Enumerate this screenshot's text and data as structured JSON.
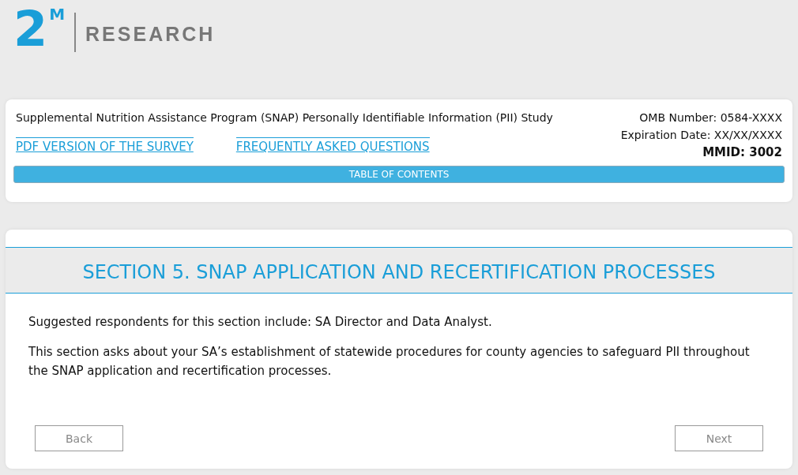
{
  "logo": {
    "mark": "2",
    "superscript": "M",
    "name": "RESEARCH"
  },
  "header": {
    "study_title": "Supplemental Nutrition Assistance Program (SNAP) Personally Identifiable Information (PII) Study",
    "links": [
      "PDF VERSION OF THE SURVEY",
      "FREQUENTLY ASKED QUESTIONS"
    ],
    "omb_number": "OMB Number: 0584-XXXX",
    "expiration": "Expiration Date: XX/XX/XXXX",
    "mmid": "MMID: 3002",
    "toc_button": "TABLE OF CONTENTS"
  },
  "section": {
    "title": "SECTION 5. SNAP APPLICATION AND RECERTIFICATION PROCESSES",
    "paragraphs": [
      "Suggested respondents for this section include: SA Director and Data Analyst.",
      "This section asks about your SA’s establishment of statewide procedures for county agencies to safeguard PII throughout the SNAP application and recertification processes."
    ],
    "buttons": [
      "Back",
      "Next"
    ]
  }
}
